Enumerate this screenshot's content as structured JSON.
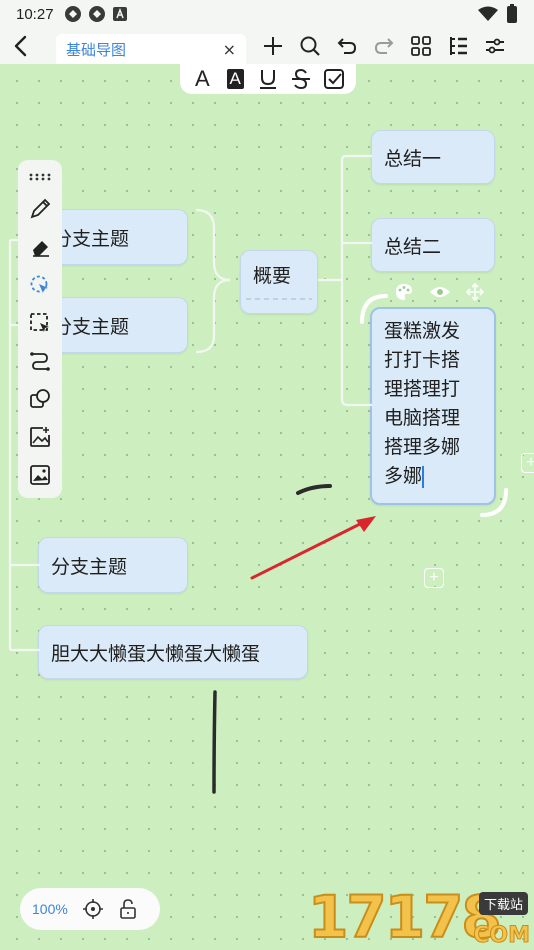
{
  "statusbar": {
    "time": "10:27"
  },
  "topbar": {
    "tab_label": "基础导图",
    "tab_close": "×",
    "tools": [
      "add-icon",
      "search-icon",
      "undo-icon",
      "redo-icon",
      "layout-grid-icon",
      "outline-icon",
      "settings-sliders-icon"
    ]
  },
  "format_bar": {
    "items": [
      "text-color",
      "text-highlight",
      "underline",
      "strikethrough",
      "checkbox"
    ],
    "text_color_glyph": "A",
    "highlight_glyph": "A"
  },
  "left_toolbar": {
    "items": [
      "drag-handle",
      "pen",
      "eraser",
      "lasso-select",
      "box-select",
      "connector",
      "shape",
      "insert-image",
      "image"
    ]
  },
  "mindmap": {
    "branches": [
      "分支主题",
      "分支主题",
      "分支主题",
      "胆大大懒蛋大懒蛋大懒蛋"
    ],
    "summary": "概要",
    "summary_children": [
      "总结一",
      "总结二"
    ],
    "editing_node_lines": [
      "蛋糕激发",
      "打打卡搭",
      "理搭理打",
      "电脑搭理",
      "搭理多娜",
      "多娜"
    ],
    "node_toolbar": [
      "palette-icon",
      "eye-icon",
      "move-icon"
    ]
  },
  "zoombar": {
    "zoom": "100%"
  },
  "watermark": {
    "digits": "17178",
    "badge": "下载站",
    "suffix": "COM"
  },
  "colors": {
    "canvas": "#cdefc0",
    "node": "#dbeaf8",
    "accent": "#3d86d8",
    "arrow": "#d9262c"
  }
}
